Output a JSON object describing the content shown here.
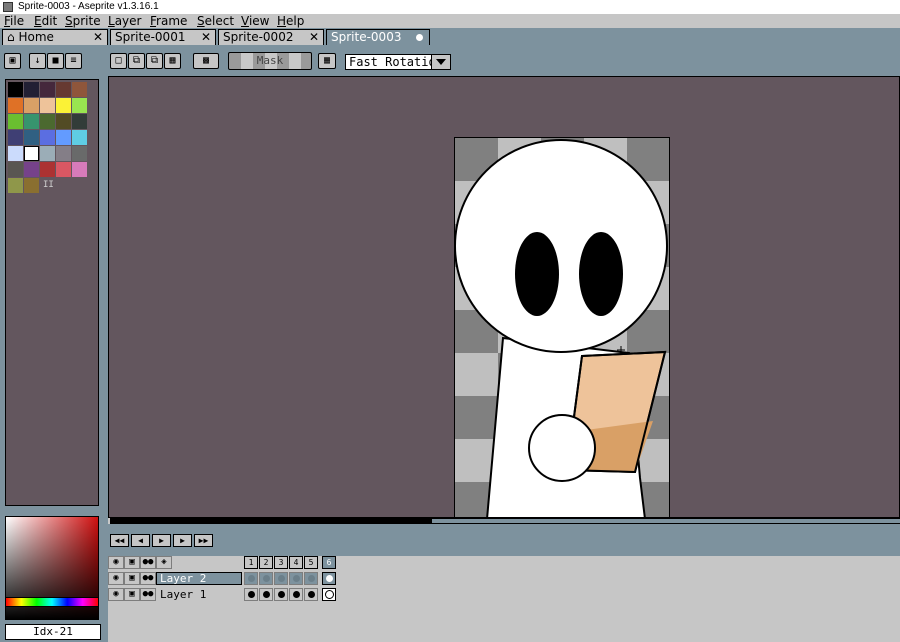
{
  "window": {
    "title": "Sprite-0003 - Aseprite v1.3.16.1"
  },
  "menu": [
    "File",
    "Edit",
    "Sprite",
    "Layer",
    "Frame",
    "Select",
    "View",
    "Help"
  ],
  "tabs": [
    {
      "label": "Home",
      "icon": "home-icon",
      "close": "✕"
    },
    {
      "label": "Sprite-0001",
      "close": "✕"
    },
    {
      "label": "Sprite-0002",
      "close": "✕"
    },
    {
      "label": "Sprite-0003",
      "active": true
    }
  ],
  "toolbar": {
    "mask_label": "Mask",
    "rotation_algorithm": "Fast Rotation"
  },
  "palette": {
    "colors": [
      "#000000",
      "#222034",
      "#45283c",
      "#663931",
      "#8f563b",
      "#df7126",
      "#d9a066",
      "#eec39a",
      "#fbf236",
      "#99e550",
      "#6abe30",
      "#37946e",
      "#4b692f",
      "#524b24",
      "#323c39",
      "#3f3f74",
      "#306082",
      "#5b6ee1",
      "#639bff",
      "#5fcde4",
      "#cbdbfc",
      "#ffffff",
      "#9badb7",
      "#847e87",
      "#696a6a",
      "#595652",
      "#76428a",
      "#ac3232",
      "#d95763",
      "#d77bba",
      "#8f974a",
      "#8a6f30"
    ],
    "trailing_marker": "II"
  },
  "colorbar": {
    "index_label": "Idx-21"
  },
  "timeline": {
    "frames": [
      "1",
      "2",
      "3",
      "4",
      "5",
      "6"
    ],
    "active_frame": 6,
    "layers": [
      {
        "name": "Layer 2",
        "selected": true
      },
      {
        "name": "Layer 1",
        "selected": false
      }
    ]
  }
}
